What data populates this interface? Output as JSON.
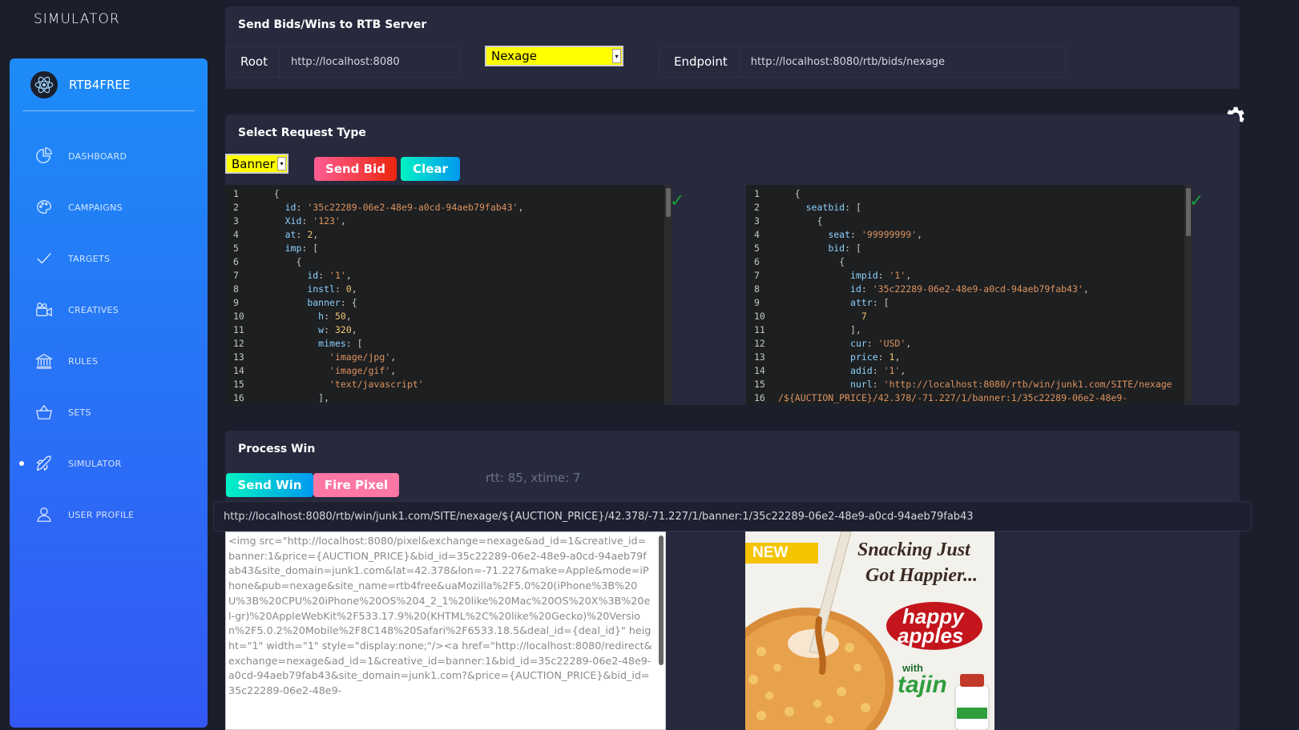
{
  "app": {
    "title": "SIMULATOR",
    "brand": "RTB4FREE"
  },
  "sidebar": {
    "items": [
      {
        "label": "DASHBOARD",
        "icon": "chart-pie-icon"
      },
      {
        "label": "CAMPAIGNS",
        "icon": "palette-icon"
      },
      {
        "label": "TARGETS",
        "icon": "check-icon"
      },
      {
        "label": "CREATIVES",
        "icon": "video-camera-icon"
      },
      {
        "label": "RULES",
        "icon": "bank-icon"
      },
      {
        "label": "SETS",
        "icon": "basket-icon"
      },
      {
        "label": "SIMULATOR",
        "icon": "spaceship-icon",
        "active": true
      },
      {
        "label": "USER PROFILE",
        "icon": "user-icon"
      }
    ]
  },
  "send_bids": {
    "title": "Send Bids/Wins to RTB Server",
    "root_label": "Root",
    "root_value": "http://localhost:8080",
    "exchange": "Nexage",
    "endpoint_label": "Endpoint",
    "endpoint_value": "http://localhost:8080/rtb/bids/nexage"
  },
  "request": {
    "title": "Select Request Type",
    "type": "Banner",
    "send_bid_label": "Send Bid",
    "clear_label": "Clear"
  },
  "process_win": {
    "title": "Process Win",
    "send_win_label": "Send Win",
    "fire_pixel_label": "Fire Pixel",
    "rtt": "rtt: 85, xtime: 7",
    "win_url": "http://localhost:8080/rtb/win/junk1.com/SITE/nexage/${AUCTION_PRICE}/42.378/-71.227/1/banner:1/35c22289-06e2-48e9-a0cd-94aeb79fab43",
    "adm": "<img src=\"http://localhost:8080/pixel&exchange=nexage&ad_id=1&creative_id=banner:1&price={AUCTION_PRICE}&bid_id=35c22289-06e2-48e9-a0cd-94aeb79fab43&site_domain=junk1.com&lat=42.378&lon=-71.227&make=Apple&mode=iPhone&pub=nexage&site_name=rtb4free&uaMozilla%2F5.0%20(iPhone%3B%20U%3B%20CPU%20iPhone%20OS%204_2_1%20like%20Mac%20OS%20X%3B%20el-gr)%20AppleWebKit%2F533.17.9%20(KHTML%2C%20like%20Gecko)%20Version%2F5.0.2%20Mobile%2F8C148%20Safari%2F6533.18.5&deal_id={deal_id}\" height=\"1\" width=\"1\" style=\"display:none;\"/><a href=\"http://localhost:8080/redirect&exchange=nexage&ad_id=1&creative_id=banner:1&bid_id=35c22289-06e2-48e9-a0cd-94aeb79fab43&site_domain=junk1.com?&price={AUCTION_PRICE}&bid_id=35c22289-06e2-48e9-"
  },
  "ad": {
    "badge": "NEW",
    "headline_1": "Snacking Just",
    "headline_2": "Got Happier...",
    "brand_1": "happy",
    "brand_2": "apples",
    "with": "with",
    "partner": "tajin"
  },
  "colors": {
    "accent_blue": "#1d8cf8",
    "accent_violet": "#3358f4",
    "yellow": "#ffff00",
    "red": "#ec250d",
    "cyan": "#00f2c3"
  }
}
